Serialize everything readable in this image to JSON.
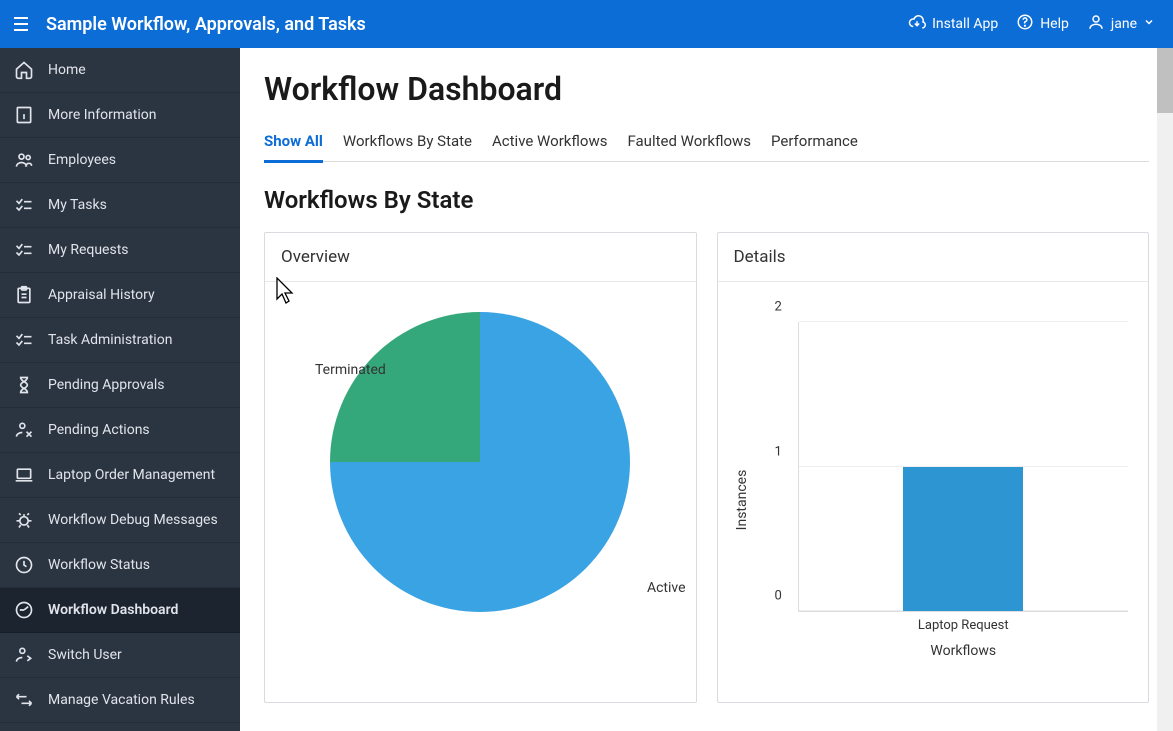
{
  "header": {
    "app_title": "Sample Workflow, Approvals, and Tasks",
    "install_app": "Install App",
    "help": "Help",
    "user": "jane"
  },
  "sidebar": {
    "items": [
      {
        "label": "Home",
        "icon": "home-icon"
      },
      {
        "label": "More Information",
        "icon": "info-icon"
      },
      {
        "label": "Employees",
        "icon": "people-icon"
      },
      {
        "label": "My Tasks",
        "icon": "checklist-icon"
      },
      {
        "label": "My Requests",
        "icon": "checklist-icon"
      },
      {
        "label": "Appraisal History",
        "icon": "clipboard-icon"
      },
      {
        "label": "Task Administration",
        "icon": "checklist-icon"
      },
      {
        "label": "Pending Approvals",
        "icon": "hourglass-icon"
      },
      {
        "label": "Pending Actions",
        "icon": "person-action-icon"
      },
      {
        "label": "Laptop Order Management",
        "icon": "laptop-icon"
      },
      {
        "label": "Workflow Debug Messages",
        "icon": "bug-icon"
      },
      {
        "label": "Workflow Status",
        "icon": "clock-icon"
      },
      {
        "label": "Workflow Dashboard",
        "icon": "dashboard-icon",
        "active": true
      },
      {
        "label": "Switch User",
        "icon": "switch-user-icon"
      },
      {
        "label": "Manage Vacation Rules",
        "icon": "timeline-icon"
      }
    ]
  },
  "page": {
    "title": "Workflow Dashboard",
    "tabs": [
      "Show All",
      "Workflows By State",
      "Active Workflows",
      "Faulted Workflows",
      "Performance"
    ],
    "active_tab_index": 0,
    "section_title": "Workflows By State",
    "cards": {
      "overview": "Overview",
      "details": "Details"
    },
    "pie_labels": {
      "terminated": "Terminated",
      "active": "Active"
    }
  },
  "chart_data": [
    {
      "type": "pie",
      "title": "Overview",
      "series": [
        {
          "name": "Active",
          "value": 3,
          "color": "#3aa3e3"
        },
        {
          "name": "Terminated",
          "value": 1,
          "color": "#34a87a"
        }
      ]
    },
    {
      "type": "bar",
      "title": "Details",
      "categories": [
        "Laptop Request"
      ],
      "values": [
        1
      ],
      "xlabel": "Workflows",
      "ylabel": "Instances",
      "ylim": [
        0,
        2
      ],
      "yticks": [
        0,
        1,
        2
      ],
      "bar_color": "#2e95d3"
    }
  ]
}
